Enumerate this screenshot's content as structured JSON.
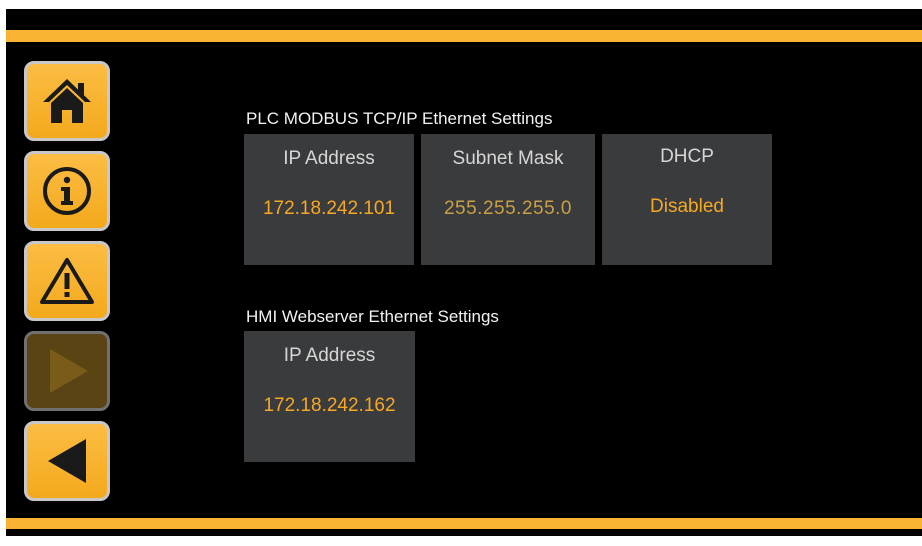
{
  "colors": {
    "accent": "#f9b233",
    "background": "#000000",
    "tile": "#3a3b3d",
    "value_text": "#f7a823"
  },
  "nav": [
    {
      "icon": "home-icon",
      "enabled": true
    },
    {
      "icon": "info-icon",
      "enabled": true
    },
    {
      "icon": "warning-icon",
      "enabled": true
    },
    {
      "icon": "play-icon",
      "enabled": false
    },
    {
      "icon": "back-icon",
      "enabled": true
    }
  ],
  "plc": {
    "title": "PLC MODBUS TCP/IP Ethernet Settings",
    "ip_label": "IP Address",
    "ip_value": "172.18.242.101",
    "subnet_label": "Subnet Mask",
    "subnet_value": "255.255.255.0",
    "dhcp_label": "DHCP",
    "dhcp_value": "Disabled"
  },
  "hmi": {
    "title": "HMI Webserver Ethernet Settings",
    "ip_label": "IP Address",
    "ip_value": "172.18.242.162"
  }
}
